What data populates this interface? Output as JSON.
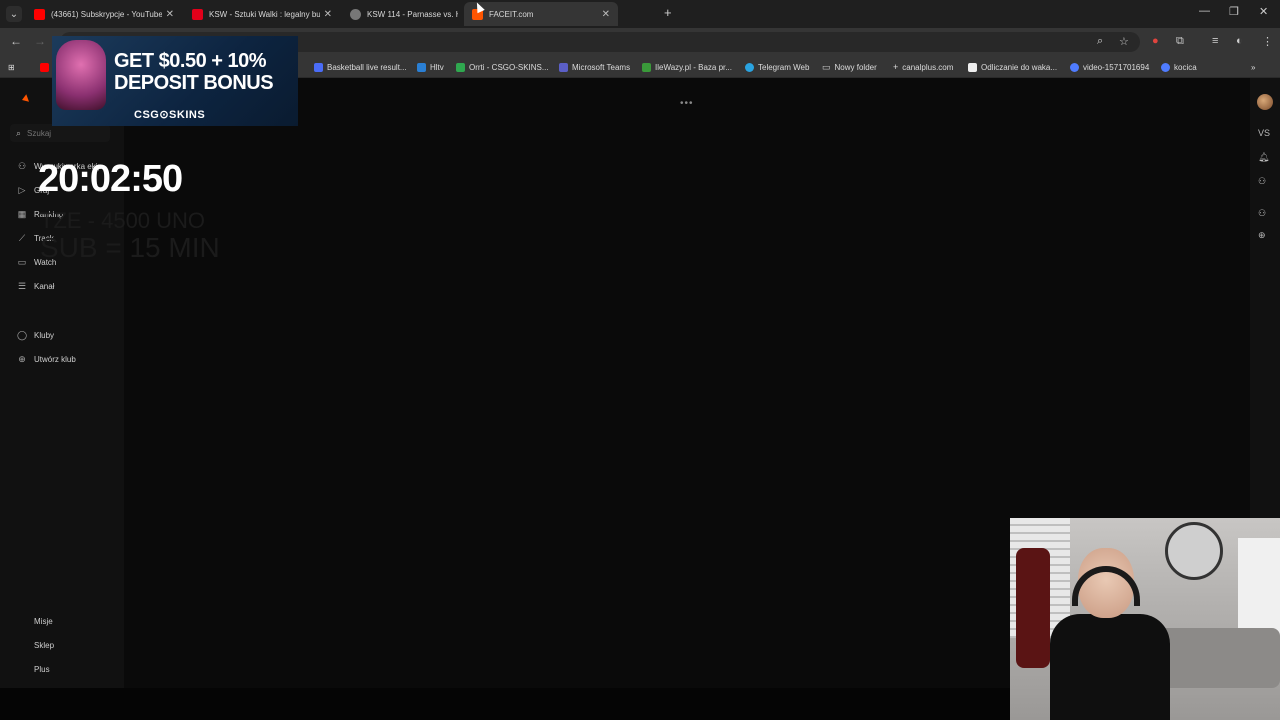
{
  "tabs": [
    {
      "title": "(43661) Subskrypcje - YouTube",
      "favicon_color": "#ff0000"
    },
    {
      "title": "KSW - Sztuki Walki : legalny bu",
      "favicon_color": "#e2001a"
    },
    {
      "title": "KSW 114 - Parnasse vs. Helc",
      "favicon_color": "#aaaaaa"
    },
    {
      "title": "FACEIT.com",
      "favicon_color": "#ff5500"
    }
  ],
  "bookmarks": [
    {
      "label": "Basketball live result...",
      "color": "#4a6cf7"
    },
    {
      "label": "Hltv",
      "color": "#2a7fd4"
    },
    {
      "label": "Orrti - CSGO-SKINS...",
      "color": "#2fa84f"
    },
    {
      "label": "Microsoft Teams",
      "color": "#5b5fc7"
    },
    {
      "label": "IleWazy.pl - Baza pr...",
      "color": "#3a9a3a"
    },
    {
      "label": "Telegram Web",
      "color": "#2aa3e0"
    },
    {
      "label": "Nowy folder",
      "color": "#cccccc"
    },
    {
      "label": "canalplus.com",
      "color": "#dddddd"
    },
    {
      "label": "Odliczanie do waka...",
      "color": "#eeeeee"
    },
    {
      "label": "video-1571701694",
      "color": "#4f7cff"
    },
    {
      "label": "kocica",
      "color": "#4f7cff"
    }
  ],
  "sidebar": {
    "search_placeholder": "Szukaj",
    "items": [
      {
        "label": "Wyszukiwarka ekip",
        "icon": "users-icon"
      },
      {
        "label": "Graj",
        "icon": "play-icon"
      },
      {
        "label": "Ranking",
        "icon": "ranking-icon"
      },
      {
        "label": "Track",
        "icon": "trend-icon"
      },
      {
        "label": "Watch",
        "icon": "video-icon"
      },
      {
        "label": "Kanał",
        "icon": "list-icon"
      },
      {
        "label": "Kluby",
        "icon": "clubs-icon"
      },
      {
        "label": "Utwórz klub",
        "icon": "plus-circle-icon"
      }
    ],
    "bottom_items": [
      {
        "label": "Misje"
      },
      {
        "label": "Sklep"
      },
      {
        "label": "Plus"
      }
    ]
  },
  "rightbar": {
    "vs_label": "VS"
  },
  "loading_indicator": "•••",
  "overlay": {
    "ad_line1": "GET $0.50 + 10%",
    "ad_line2": "DEPOSIT BONUS",
    "ad_brand": "CSG⊙SKINS",
    "clock": "20:02:50",
    "ghost_line1": "TZE - 4500 UNO",
    "ghost_line2": "SUB = 15 MIN"
  }
}
